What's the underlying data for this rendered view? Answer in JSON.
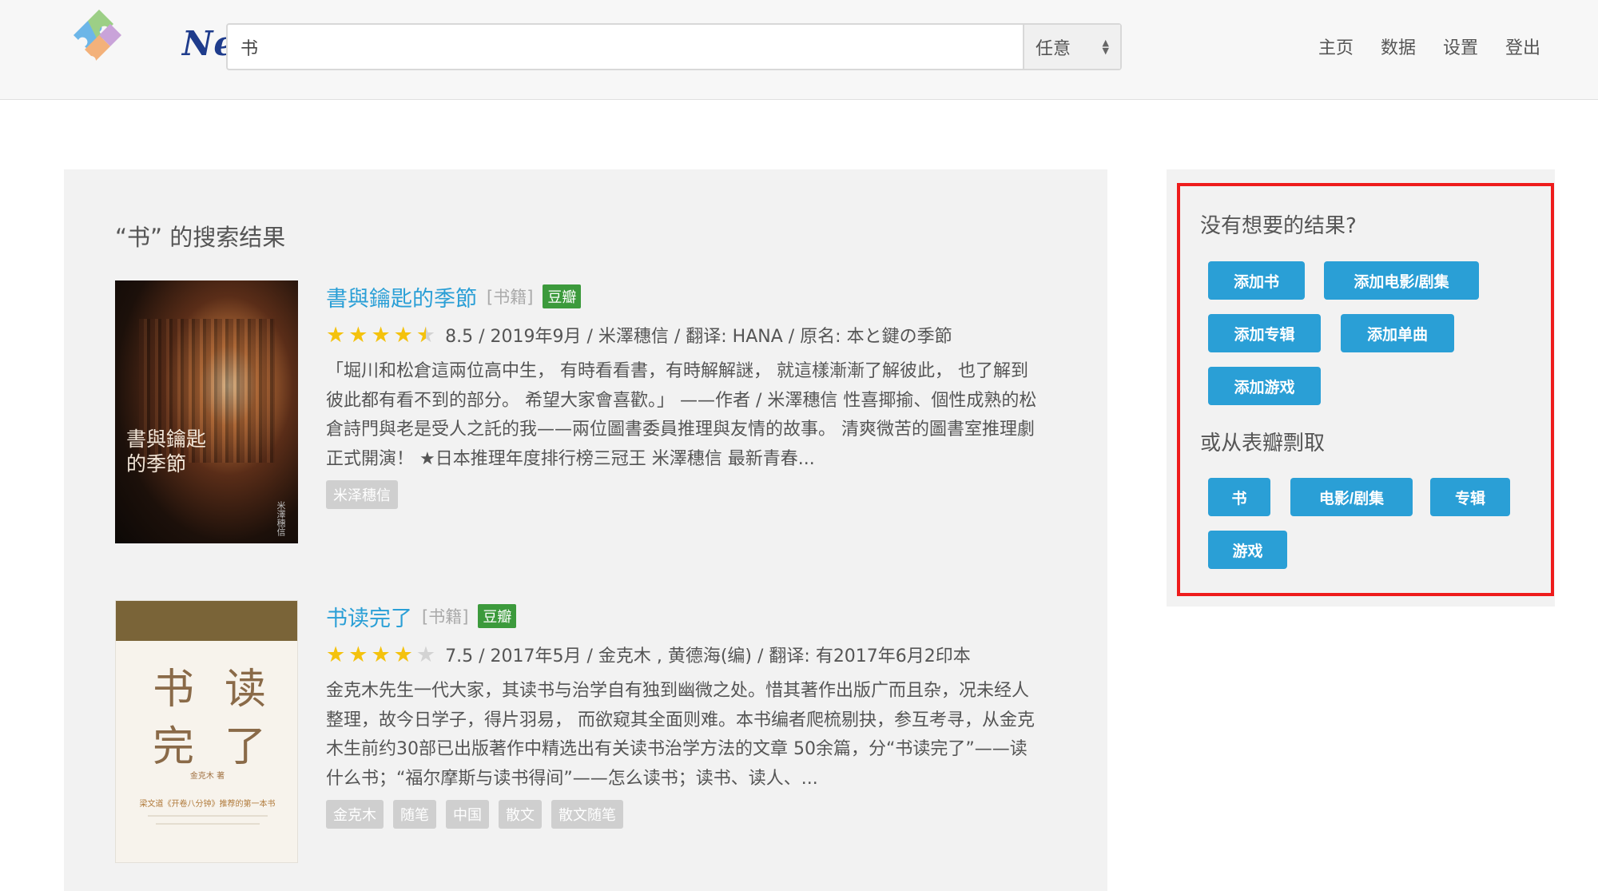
{
  "header": {
    "logo_text": "NeoDB",
    "search_value": "书",
    "search_category": "任意",
    "nav": [
      "主页",
      "数据",
      "设置",
      "登出"
    ]
  },
  "results": {
    "title": "“书” 的搜索结果",
    "items": [
      {
        "title": "書與鑰匙的季節",
        "category": "[书籍]",
        "source": "豆瓣",
        "rating": 8.5,
        "meta": "8.5 / 2019年9月 / 米澤穗信 / 翻译: HANA / 原名: 本と鍵の季節",
        "description": "「堀川和松倉這兩位高中生， 有時看看書，有時解解謎， 就這樣漸漸了解彼此， 也了解到彼此都有看不到的部分。 希望大家會喜歡。」 ——作者 / 米澤穗信 性喜揶揄、個性成熟的松倉詩門與老是受人之託的我——兩位圖書委員推理與友情的故事。 清爽微苦的圖書室推理劇正式開演！ ★日本推理年度排行榜三冠王 米澤穗信 最新青春...",
        "tags": [
          "米泽穗信"
        ],
        "cover": {
          "title_text": "書與鑰匙的季節",
          "author_text": "米澤穗信"
        }
      },
      {
        "title": "书读完了",
        "category": "[书籍]",
        "source": "豆瓣",
        "rating": 7.5,
        "meta": "7.5 / 2017年5月 / 金克木 , 黄德海(编) / 翻译: 有2017年6月2印本",
        "description": "金克木先生一代大家，其读书与治学自有独到幽微之处。惜其著作出版广而且杂，况未经人整理，故今日学子，得片羽易， 而欲窥其全面则难。本书编者爬梳剔抉，参互考寻，从金克木生前约30部已出版著作中精选出有关读书治学方法的文章 50余篇，分“书读完了”——读什么书；“福尔摩斯与读书得间”——怎么读书；读书、读人、...",
        "tags": [
          "金克木",
          "随笔",
          "中国",
          "散文",
          "散文随笔"
        ],
        "cover": {
          "chars": [
            "书",
            "读",
            "完",
            "了"
          ],
          "author_text": "金克木 著",
          "subtitle": "梁文道《开卷八分钟》推荐的第一本书"
        }
      }
    ]
  },
  "sidebar": {
    "heading1": "没有想要的结果?",
    "add_buttons": [
      "添加书",
      "添加电影/剧集",
      "添加专辑",
      "添加单曲",
      "添加游戏"
    ],
    "heading2": "或从表瓣剽取",
    "fetch_buttons": [
      "书",
      "电影/剧集",
      "专辑",
      "游戏"
    ]
  },
  "colors": {
    "link": "#2a9fd6",
    "button": "#2a9fd6",
    "source_badge": "#3c9a3c",
    "star": "#f4c20d",
    "highlight_border": "#ee1c1c"
  }
}
